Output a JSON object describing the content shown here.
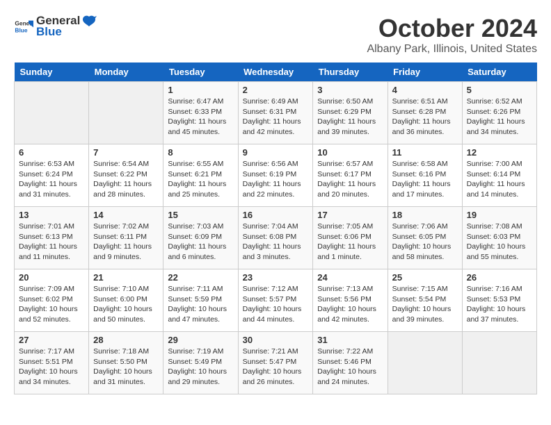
{
  "header": {
    "logo_general": "General",
    "logo_blue": "Blue",
    "month": "October 2024",
    "location": "Albany Park, Illinois, United States"
  },
  "days_of_week": [
    "Sunday",
    "Monday",
    "Tuesday",
    "Wednesday",
    "Thursday",
    "Friday",
    "Saturday"
  ],
  "weeks": [
    [
      {
        "day": "",
        "empty": true
      },
      {
        "day": "",
        "empty": true
      },
      {
        "day": "1",
        "sunrise": "6:47 AM",
        "sunset": "6:33 PM",
        "daylight": "11 hours and 45 minutes."
      },
      {
        "day": "2",
        "sunrise": "6:49 AM",
        "sunset": "6:31 PM",
        "daylight": "11 hours and 42 minutes."
      },
      {
        "day": "3",
        "sunrise": "6:50 AM",
        "sunset": "6:29 PM",
        "daylight": "11 hours and 39 minutes."
      },
      {
        "day": "4",
        "sunrise": "6:51 AM",
        "sunset": "6:28 PM",
        "daylight": "11 hours and 36 minutes."
      },
      {
        "day": "5",
        "sunrise": "6:52 AM",
        "sunset": "6:26 PM",
        "daylight": "11 hours and 34 minutes."
      }
    ],
    [
      {
        "day": "6",
        "sunrise": "6:53 AM",
        "sunset": "6:24 PM",
        "daylight": "11 hours and 31 minutes."
      },
      {
        "day": "7",
        "sunrise": "6:54 AM",
        "sunset": "6:22 PM",
        "daylight": "11 hours and 28 minutes."
      },
      {
        "day": "8",
        "sunrise": "6:55 AM",
        "sunset": "6:21 PM",
        "daylight": "11 hours and 25 minutes."
      },
      {
        "day": "9",
        "sunrise": "6:56 AM",
        "sunset": "6:19 PM",
        "daylight": "11 hours and 22 minutes."
      },
      {
        "day": "10",
        "sunrise": "6:57 AM",
        "sunset": "6:17 PM",
        "daylight": "11 hours and 20 minutes."
      },
      {
        "day": "11",
        "sunrise": "6:58 AM",
        "sunset": "6:16 PM",
        "daylight": "11 hours and 17 minutes."
      },
      {
        "day": "12",
        "sunrise": "7:00 AM",
        "sunset": "6:14 PM",
        "daylight": "11 hours and 14 minutes."
      }
    ],
    [
      {
        "day": "13",
        "sunrise": "7:01 AM",
        "sunset": "6:13 PM",
        "daylight": "11 hours and 11 minutes."
      },
      {
        "day": "14",
        "sunrise": "7:02 AM",
        "sunset": "6:11 PM",
        "daylight": "11 hours and 9 minutes."
      },
      {
        "day": "15",
        "sunrise": "7:03 AM",
        "sunset": "6:09 PM",
        "daylight": "11 hours and 6 minutes."
      },
      {
        "day": "16",
        "sunrise": "7:04 AM",
        "sunset": "6:08 PM",
        "daylight": "11 hours and 3 minutes."
      },
      {
        "day": "17",
        "sunrise": "7:05 AM",
        "sunset": "6:06 PM",
        "daylight": "11 hours and 1 minute."
      },
      {
        "day": "18",
        "sunrise": "7:06 AM",
        "sunset": "6:05 PM",
        "daylight": "10 hours and 58 minutes."
      },
      {
        "day": "19",
        "sunrise": "7:08 AM",
        "sunset": "6:03 PM",
        "daylight": "10 hours and 55 minutes."
      }
    ],
    [
      {
        "day": "20",
        "sunrise": "7:09 AM",
        "sunset": "6:02 PM",
        "daylight": "10 hours and 52 minutes."
      },
      {
        "day": "21",
        "sunrise": "7:10 AM",
        "sunset": "6:00 PM",
        "daylight": "10 hours and 50 minutes."
      },
      {
        "day": "22",
        "sunrise": "7:11 AM",
        "sunset": "5:59 PM",
        "daylight": "10 hours and 47 minutes."
      },
      {
        "day": "23",
        "sunrise": "7:12 AM",
        "sunset": "5:57 PM",
        "daylight": "10 hours and 44 minutes."
      },
      {
        "day": "24",
        "sunrise": "7:13 AM",
        "sunset": "5:56 PM",
        "daylight": "10 hours and 42 minutes."
      },
      {
        "day": "25",
        "sunrise": "7:15 AM",
        "sunset": "5:54 PM",
        "daylight": "10 hours and 39 minutes."
      },
      {
        "day": "26",
        "sunrise": "7:16 AM",
        "sunset": "5:53 PM",
        "daylight": "10 hours and 37 minutes."
      }
    ],
    [
      {
        "day": "27",
        "sunrise": "7:17 AM",
        "sunset": "5:51 PM",
        "daylight": "10 hours and 34 minutes."
      },
      {
        "day": "28",
        "sunrise": "7:18 AM",
        "sunset": "5:50 PM",
        "daylight": "10 hours and 31 minutes."
      },
      {
        "day": "29",
        "sunrise": "7:19 AM",
        "sunset": "5:49 PM",
        "daylight": "10 hours and 29 minutes."
      },
      {
        "day": "30",
        "sunrise": "7:21 AM",
        "sunset": "5:47 PM",
        "daylight": "10 hours and 26 minutes."
      },
      {
        "day": "31",
        "sunrise": "7:22 AM",
        "sunset": "5:46 PM",
        "daylight": "10 hours and 24 minutes."
      },
      {
        "day": "",
        "empty": true
      },
      {
        "day": "",
        "empty": true
      }
    ]
  ],
  "labels": {
    "sunrise": "Sunrise:",
    "sunset": "Sunset:",
    "daylight": "Daylight:"
  }
}
